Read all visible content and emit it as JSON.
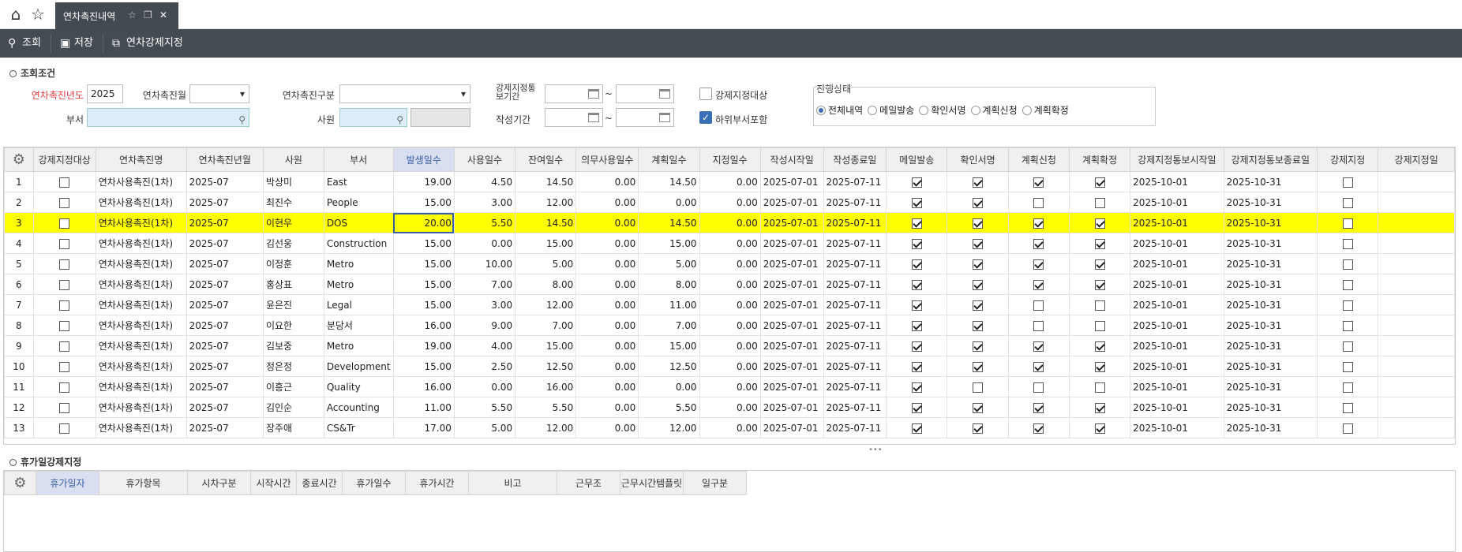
{
  "tab": {
    "title": "연차촉진내역"
  },
  "toolbar": {
    "search": "조회",
    "save": "저장",
    "force": "연차강제지정"
  },
  "cond": {
    "section_title": "조회조건",
    "year_label": "연차촉진년도",
    "year_value": "2025",
    "month_label": "연차촉진월",
    "type_label": "연차촉진구분",
    "notice_label": "강제지정통보기간",
    "dept_label": "부서",
    "emp_label": "사원",
    "write_label": "작성기간",
    "tilde": "~",
    "force_target_label": "강제지정대상",
    "sub_dept_label": "하위부서포함",
    "status_legend": "진행상태",
    "status_options": [
      "전체내역",
      "메일발송",
      "확인서명",
      "계획신청",
      "계획확정"
    ]
  },
  "grid": {
    "headers": [
      "강제지정대상",
      "연차촉진명",
      "연차촉진년월",
      "사원",
      "부서",
      "발생일수",
      "사용일수",
      "잔여일수",
      "의무사용일수",
      "계획일수",
      "지정일수",
      "작성시작일",
      "작성종료일",
      "메일발송",
      "확인서명",
      "계획신청",
      "계획확정",
      "강제지정통보시작일",
      "강제지정통보종료일",
      "강제지정",
      "강제지정일"
    ],
    "rows": [
      {
        "no": "1",
        "name": "연차사용촉진(1차)",
        "ym": "2025-07",
        "emp": "박상미",
        "dept": "East",
        "occ": "19.00",
        "used": "4.50",
        "rem": "14.50",
        "duty": "0.00",
        "plan": "14.50",
        "assign": "0.00",
        "ws": "2025-07-01",
        "we": "2025-07-11",
        "mail": true,
        "sign": true,
        "req": true,
        "conf": true,
        "ns": "2025-10-01",
        "ne": "2025-10-31"
      },
      {
        "no": "2",
        "name": "연차사용촉진(1차)",
        "ym": "2025-07",
        "emp": "최진수",
        "dept": "People",
        "occ": "15.00",
        "used": "3.00",
        "rem": "12.00",
        "duty": "0.00",
        "plan": "0.00",
        "assign": "0.00",
        "ws": "2025-07-01",
        "we": "2025-07-11",
        "mail": true,
        "sign": true,
        "req": false,
        "conf": false,
        "ns": "2025-10-01",
        "ne": "2025-10-31"
      },
      {
        "no": "3",
        "name": "연차사용촉진(1차)",
        "ym": "2025-07",
        "emp": "이현우",
        "dept": "DOS",
        "occ": "20.00",
        "used": "5.50",
        "rem": "14.50",
        "duty": "0.00",
        "plan": "14.50",
        "assign": "0.00",
        "ws": "2025-07-01",
        "we": "2025-07-11",
        "mail": true,
        "sign": true,
        "req": true,
        "conf": true,
        "ns": "2025-10-01",
        "ne": "2025-10-31"
      },
      {
        "no": "4",
        "name": "연차사용촉진(1차)",
        "ym": "2025-07",
        "emp": "김선웅",
        "dept": "Construction",
        "occ": "15.00",
        "used": "0.00",
        "rem": "15.00",
        "duty": "0.00",
        "plan": "15.00",
        "assign": "0.00",
        "ws": "2025-07-01",
        "we": "2025-07-11",
        "mail": true,
        "sign": true,
        "req": true,
        "conf": true,
        "ns": "2025-10-01",
        "ne": "2025-10-31"
      },
      {
        "no": "5",
        "name": "연차사용촉진(1차)",
        "ym": "2025-07",
        "emp": "이정훈",
        "dept": "Metro",
        "occ": "15.00",
        "used": "10.00",
        "rem": "5.00",
        "duty": "0.00",
        "plan": "5.00",
        "assign": "0.00",
        "ws": "2025-07-01",
        "we": "2025-07-11",
        "mail": true,
        "sign": true,
        "req": true,
        "conf": true,
        "ns": "2025-10-01",
        "ne": "2025-10-31"
      },
      {
        "no": "6",
        "name": "연차사용촉진(1차)",
        "ym": "2025-07",
        "emp": "홍상표",
        "dept": "Metro",
        "occ": "15.00",
        "used": "7.00",
        "rem": "8.00",
        "duty": "0.00",
        "plan": "8.00",
        "assign": "0.00",
        "ws": "2025-07-01",
        "we": "2025-07-11",
        "mail": true,
        "sign": true,
        "req": true,
        "conf": true,
        "ns": "2025-10-01",
        "ne": "2025-10-31"
      },
      {
        "no": "7",
        "name": "연차사용촉진(1차)",
        "ym": "2025-07",
        "emp": "윤은진",
        "dept": "Legal",
        "occ": "15.00",
        "used": "3.00",
        "rem": "12.00",
        "duty": "0.00",
        "plan": "11.00",
        "assign": "0.00",
        "ws": "2025-07-01",
        "we": "2025-07-11",
        "mail": true,
        "sign": true,
        "req": false,
        "conf": false,
        "ns": "2025-10-01",
        "ne": "2025-10-31"
      },
      {
        "no": "8",
        "name": "연차사용촉진(1차)",
        "ym": "2025-07",
        "emp": "이요한",
        "dept": "분당서",
        "occ": "16.00",
        "used": "9.00",
        "rem": "7.00",
        "duty": "0.00",
        "plan": "7.00",
        "assign": "0.00",
        "ws": "2025-07-01",
        "we": "2025-07-11",
        "mail": true,
        "sign": true,
        "req": false,
        "conf": false,
        "ns": "2025-10-01",
        "ne": "2025-10-31"
      },
      {
        "no": "9",
        "name": "연차사용촉진(1차)",
        "ym": "2025-07",
        "emp": "김보중",
        "dept": "Metro",
        "occ": "19.00",
        "used": "4.00",
        "rem": "15.00",
        "duty": "0.00",
        "plan": "15.00",
        "assign": "0.00",
        "ws": "2025-07-01",
        "we": "2025-07-11",
        "mail": true,
        "sign": true,
        "req": true,
        "conf": true,
        "ns": "2025-10-01",
        "ne": "2025-10-31"
      },
      {
        "no": "10",
        "name": "연차사용촉진(1차)",
        "ym": "2025-07",
        "emp": "정은정",
        "dept": "Development",
        "occ": "15.00",
        "used": "2.50",
        "rem": "12.50",
        "duty": "0.00",
        "plan": "12.50",
        "assign": "0.00",
        "ws": "2025-07-01",
        "we": "2025-07-11",
        "mail": true,
        "sign": true,
        "req": true,
        "conf": true,
        "ns": "2025-10-01",
        "ne": "2025-10-31"
      },
      {
        "no": "11",
        "name": "연차사용촉진(1차)",
        "ym": "2025-07",
        "emp": "이흥근",
        "dept": "Quality",
        "occ": "16.00",
        "used": "0.00",
        "rem": "16.00",
        "duty": "0.00",
        "plan": "0.00",
        "assign": "0.00",
        "ws": "2025-07-01",
        "we": "2025-07-11",
        "mail": true,
        "sign": false,
        "req": false,
        "conf": false,
        "ns": "2025-10-01",
        "ne": "2025-10-31"
      },
      {
        "no": "12",
        "name": "연차사용촉진(1차)",
        "ym": "2025-07",
        "emp": "김인순",
        "dept": "Accounting",
        "occ": "11.00",
        "used": "5.50",
        "rem": "5.50",
        "duty": "0.00",
        "plan": "5.50",
        "assign": "0.00",
        "ws": "2025-07-01",
        "we": "2025-07-11",
        "mail": true,
        "sign": true,
        "req": true,
        "conf": true,
        "ns": "2025-10-01",
        "ne": "2025-10-31"
      },
      {
        "no": "13",
        "name": "연차사용촉진(1차)",
        "ym": "2025-07",
        "emp": "장주애",
        "dept": "CS&Tr",
        "occ": "17.00",
        "used": "5.00",
        "rem": "12.00",
        "duty": "0.00",
        "plan": "12.00",
        "assign": "0.00",
        "ws": "2025-07-01",
        "we": "2025-07-11",
        "mail": true,
        "sign": true,
        "req": true,
        "conf": true,
        "ns": "2025-10-01",
        "ne": "2025-10-31"
      }
    ]
  },
  "bottom": {
    "section_title": "휴가일강제지정",
    "headers": [
      "휴가일자",
      "휴가항목",
      "시차구분",
      "시작시간",
      "종료시간",
      "휴가일수",
      "휴가시간",
      "비고",
      "근무조",
      "근무시간템플릿",
      "일구분"
    ]
  }
}
